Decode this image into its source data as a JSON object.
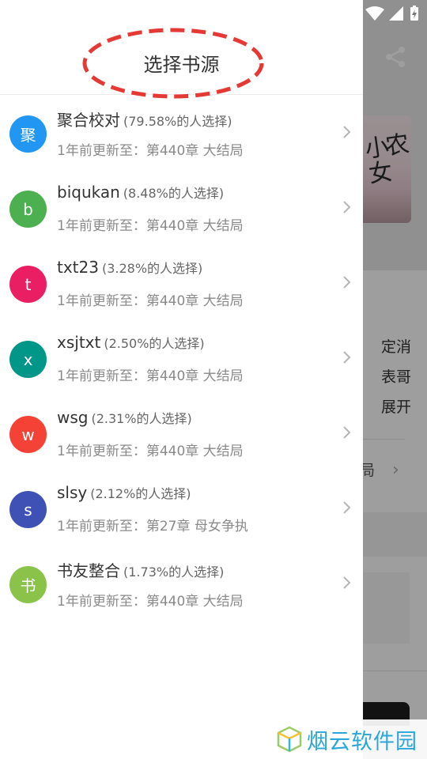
{
  "drawer": {
    "title": "选择书源"
  },
  "sources": [
    {
      "avatar_char": "聚",
      "avatar_color": "#2196f3",
      "name": "聚合校对",
      "percent": "(79.58%的人选择)",
      "update": "1年前更新至：第440章 大结局"
    },
    {
      "avatar_char": "b",
      "avatar_color": "#4caf50",
      "name": "biqukan",
      "percent": "(8.48%的人选择)",
      "update": "1年前更新至：第440章 大结局"
    },
    {
      "avatar_char": "t",
      "avatar_color": "#e91e63",
      "name": "txt23",
      "percent": "(3.28%的人选择)",
      "update": "1年前更新至：第440章 大结局"
    },
    {
      "avatar_char": "x",
      "avatar_color": "#009688",
      "name": "xsjtxt",
      "percent": "(2.50%的人选择)",
      "update": "1年前更新至：第440章 大结局"
    },
    {
      "avatar_char": "w",
      "avatar_color": "#f44336",
      "name": "wsg",
      "percent": "(2.31%的人选择)",
      "update": "1年前更新至：第440章 大结局"
    },
    {
      "avatar_char": "s",
      "avatar_color": "#3f51b5",
      "name": "slsy",
      "percent": "(2.12%的人选择)",
      "update": "1年前更新至：第27章 母女争执"
    },
    {
      "avatar_char": "书",
      "avatar_color": "#8bc34a",
      "name": "书友整合",
      "percent": "(1.73%的人选择)",
      "update": "1年前更新至：第440章 大结局"
    }
  ],
  "background": {
    "cover_title": "小农女",
    "text_line1": "定消",
    "text_line2": "表哥",
    "text_line3": "展开",
    "chapter_suffix": "局"
  },
  "watermark": {
    "text": "烟云软件园"
  },
  "colors": {
    "highlight_ellipse": "#e53935",
    "watermark_blue": "#2aa6d8"
  },
  "icons": {
    "share": "share-icon",
    "chevron": "chevron-right-icon",
    "wifi": "wifi-icon",
    "signal": "signal-icon",
    "battery": "battery-charging-icon"
  }
}
